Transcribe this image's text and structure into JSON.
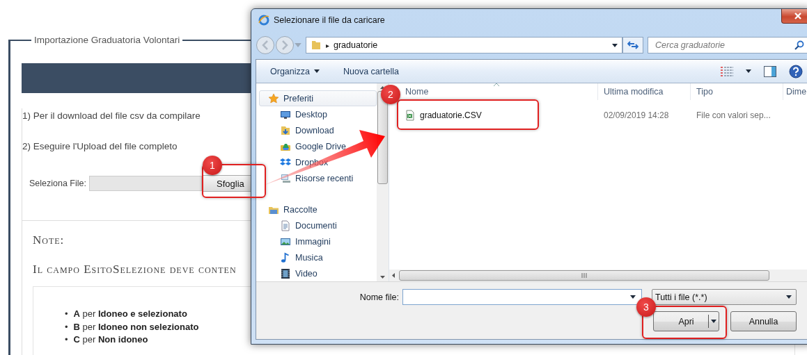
{
  "page": {
    "legend": "Importazione Graduatoria Volontari",
    "steps": [
      "1) Per il download del file csv da compilare",
      "2) Eseguire l'Upload del file completo"
    ],
    "file_label": "Seleziona File:",
    "browse_button": "Sfoglia",
    "note_title": "Note:",
    "note_text": "Il campo EsitoSelezione deve conten",
    "codes": [
      {
        "bullet": "•",
        "text": "**A** per **Idoneo e selezionato**"
      },
      {
        "bullet": "•",
        "text": "**B** per **Idoneo non selezionato**"
      },
      {
        "bullet": "•",
        "text": "**C** per **Non idoneo**"
      }
    ]
  },
  "dialog": {
    "title": "Selezionare il file da caricare",
    "path_arrow": "▸",
    "path": "graduatorie",
    "search": {
      "placeholder": "Cerca graduatorie"
    },
    "toolbar": [
      "Organizza",
      "Nuova cartella"
    ],
    "nav": [
      {
        "label": "Preferiti",
        "selected": true,
        "children": [
          {
            "label": "Desktop",
            "selected": false
          },
          {
            "label": "Download",
            "selected": false
          },
          {
            "label": "Google Drive",
            "selected": false
          },
          {
            "label": "Dropbox",
            "selected": false
          },
          {
            "label": "Risorse recenti",
            "selected": false
          }
        ]
      },
      {
        "label": "Raccolte",
        "selected": false,
        "children": [
          {
            "label": "Documenti",
            "selected": false
          },
          {
            "label": "Immagini",
            "selected": false
          },
          {
            "label": "Musica",
            "selected": false
          },
          {
            "label": "Video",
            "selected": false
          }
        ]
      }
    ],
    "columns": [
      "Nome",
      "Ultima modifica",
      "Tipo",
      "Dime"
    ],
    "files": [
      {
        "name": "graduatorie.CSV",
        "modified": "02/09/2019 14:28",
        "type": "File con valori sep..."
      }
    ],
    "filename_label": "Nome file:",
    "filter": "Tutti i file (*.*)",
    "buttons": [
      "Apri",
      "Annulla"
    ]
  },
  "annotations": [
    {
      "number": "1"
    },
    {
      "number": "2"
    },
    {
      "number": "3"
    }
  ]
}
